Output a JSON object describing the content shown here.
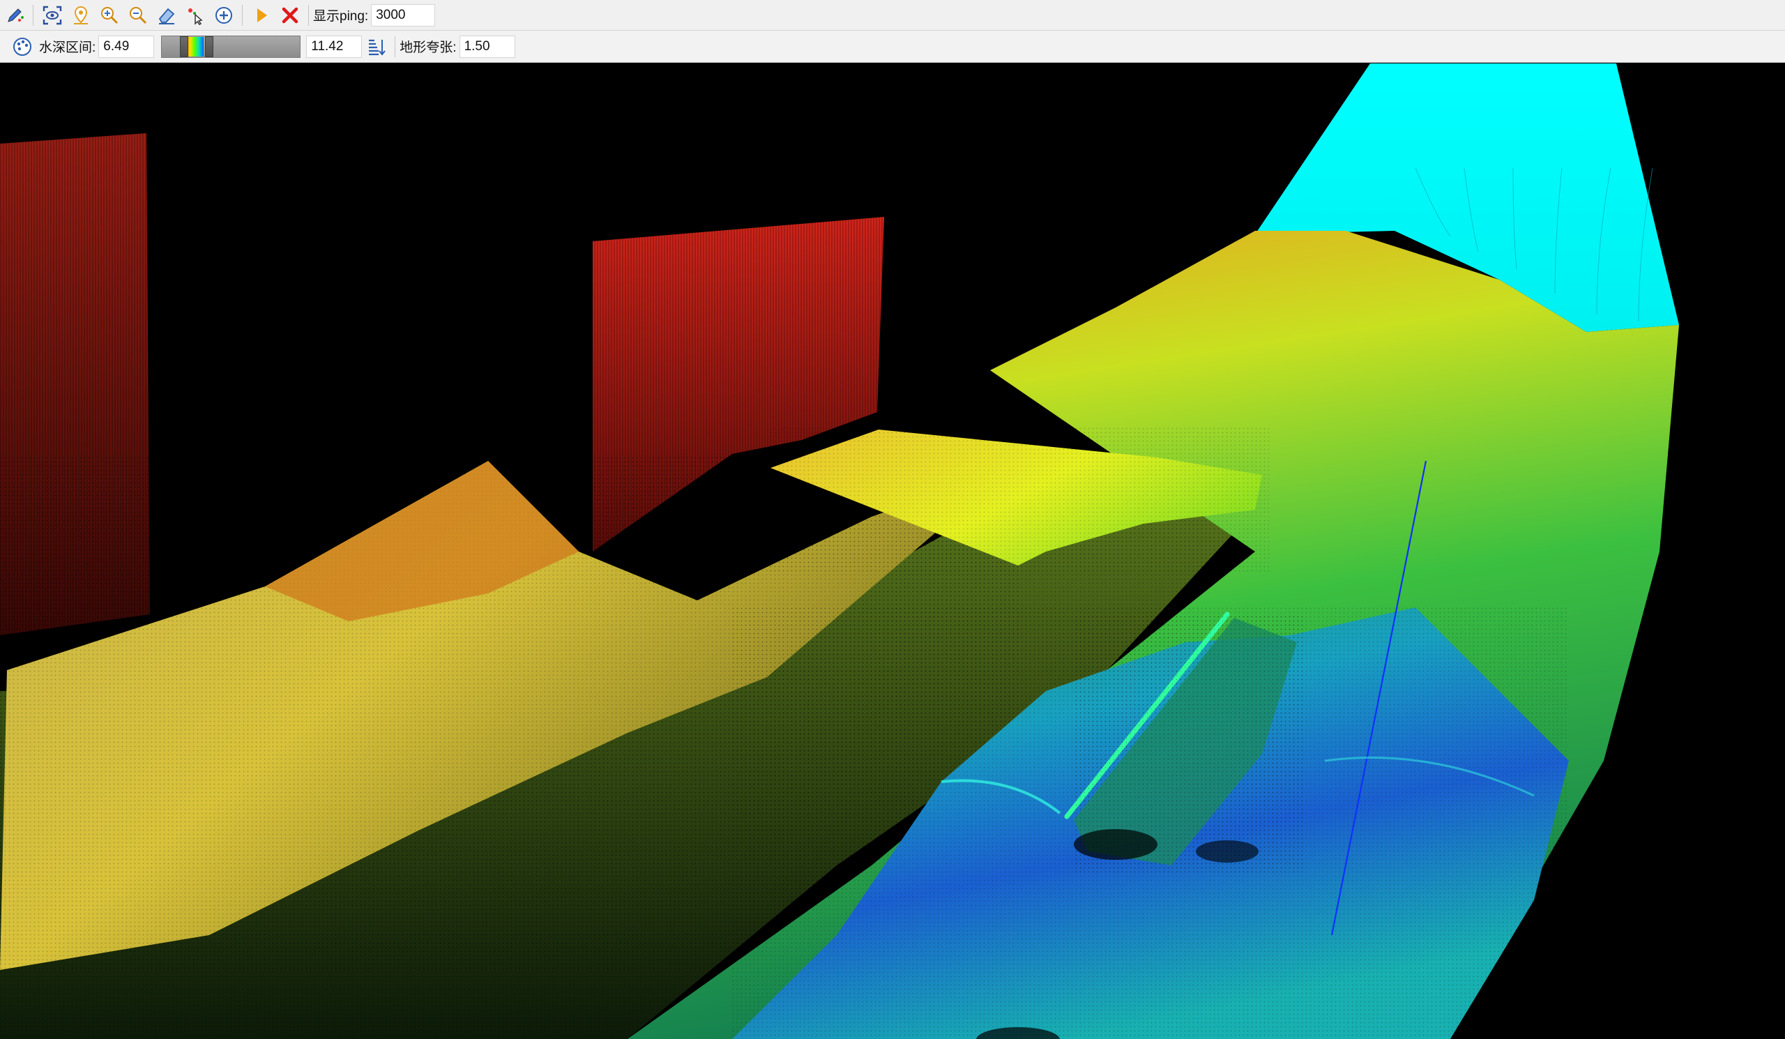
{
  "toolbar_top": {
    "tools": [
      {
        "name": "edit-points",
        "icon": "pencil-points-icon"
      },
      {
        "name": "view-all",
        "icon": "eye-frame-icon"
      },
      {
        "name": "locate",
        "icon": "location-pin-icon"
      },
      {
        "name": "zoom-in",
        "icon": "zoom-in-icon"
      },
      {
        "name": "zoom-out",
        "icon": "zoom-out-icon"
      },
      {
        "name": "eraser",
        "icon": "eraser-icon"
      },
      {
        "name": "select",
        "icon": "pointer-select-icon"
      },
      {
        "name": "center",
        "icon": "circle-plus-icon"
      },
      {
        "name": "play",
        "icon": "play-icon"
      },
      {
        "name": "stop",
        "icon": "close-x-icon"
      }
    ],
    "ping_label": "显示ping:",
    "ping_value": "3000"
  },
  "toolbar_depth": {
    "palette_icon": "palette-icon",
    "depth_label": "水深区间:",
    "depth_min": "6.49",
    "depth_max": "11.42",
    "sort_icon": "sort-depth-icon",
    "exaggeration_label": "地形夸张:",
    "exaggeration_value": "1.50"
  },
  "colors": {
    "toolbar_bg": "#f0f0f0",
    "viewport_bg": "#000000",
    "beam_cyan": "#00ffff",
    "deep": "#1030ff",
    "mid": "#20d0c0",
    "shallow": "#ffe000",
    "tall": "#c41a12"
  },
  "viewport": {
    "type": "3d-point-cloud",
    "description_colors": [
      "red",
      "orange",
      "yellow",
      "green",
      "cyan",
      "blue"
    ]
  }
}
